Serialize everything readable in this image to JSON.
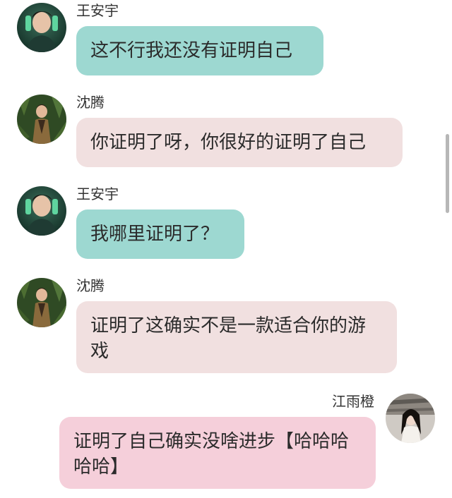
{
  "messages": [
    {
      "sender": "王安宇",
      "text": "这不行我还没有证明自己",
      "side": "left",
      "avatar_icon": "avatar-wang-anyu-icon",
      "bubble_color": "#9dd8d1"
    },
    {
      "sender": "沈腾",
      "text": "你证明了呀，你很好的证明了自己",
      "side": "left",
      "avatar_icon": "avatar-shen-teng-icon",
      "bubble_color": "#f1e0e0"
    },
    {
      "sender": "王安宇",
      "text": "我哪里证明了？",
      "side": "left",
      "avatar_icon": "avatar-wang-anyu-icon",
      "bubble_color": "#9dd8d1"
    },
    {
      "sender": "沈腾",
      "text": "证明了这确实不是一款适合你的游戏",
      "side": "left",
      "avatar_icon": "avatar-shen-teng-icon",
      "bubble_color": "#f1e0e0"
    },
    {
      "sender": "江雨橙",
      "text": "证明了自己确实没啥进步【哈哈哈哈哈】",
      "side": "right",
      "avatar_icon": "avatar-jiang-yucheng-icon",
      "bubble_color": "#f5cfda"
    }
  ]
}
